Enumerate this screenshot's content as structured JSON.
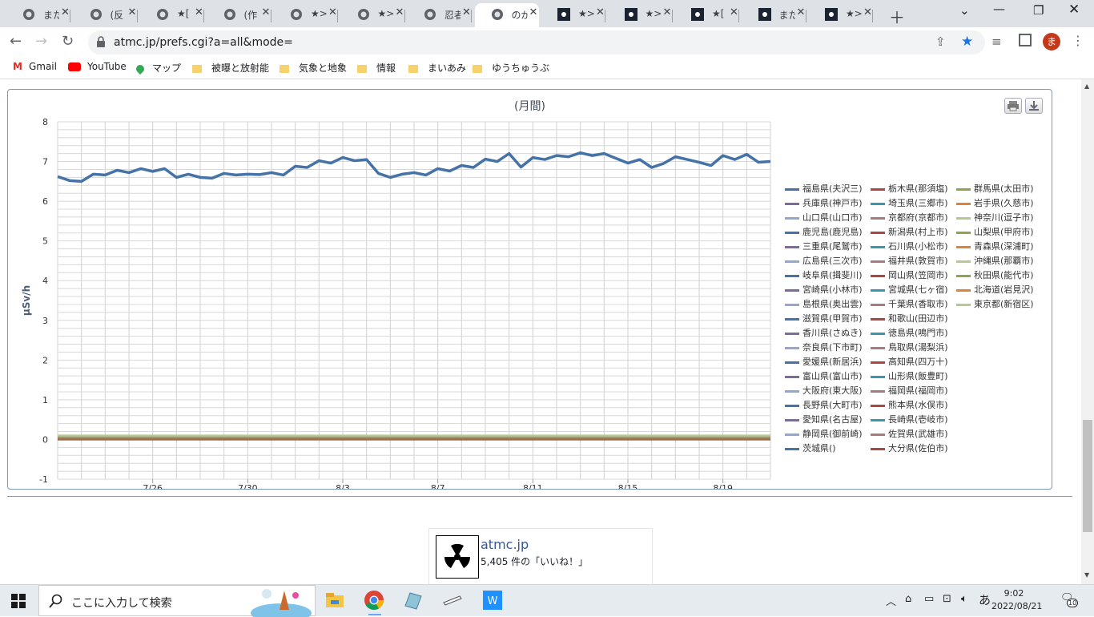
{
  "tabs": [
    {
      "title": "また",
      "active": false,
      "favicon": "globe-icon"
    },
    {
      "title": "(反",
      "active": false,
      "favicon": "globe-icon"
    },
    {
      "title": "★[",
      "active": false,
      "favicon": "globe-icon"
    },
    {
      "title": "(作",
      "active": false,
      "favicon": "globe-icon"
    },
    {
      "title": "★>",
      "active": false,
      "favicon": "globe-icon"
    },
    {
      "title": "★>",
      "active": false,
      "favicon": "globe-icon"
    },
    {
      "title": "忍者",
      "active": false,
      "favicon": "globe-icon"
    },
    {
      "title": "のが",
      "active": true,
      "favicon": "globe-icon"
    },
    {
      "title": "★>",
      "active": false,
      "favicon": "atmc-icon"
    },
    {
      "title": "★>",
      "active": false,
      "favicon": "atmc-icon"
    },
    {
      "title": "★[",
      "active": false,
      "favicon": "atmc-icon"
    },
    {
      "title": "また",
      "active": false,
      "favicon": "atmc-icon"
    },
    {
      "title": "★>",
      "active": false,
      "favicon": "atmc-icon"
    }
  ],
  "toolbar": {
    "url": "atmc.jp/prefs.cgi?a=all&mode=",
    "profile_initial": "ま"
  },
  "bookmarks": [
    {
      "label": "Gmail",
      "icon": "gmail-icon"
    },
    {
      "label": "YouTube",
      "icon": "youtube-icon"
    },
    {
      "label": "マップ",
      "icon": "maps-icon"
    },
    {
      "label": "被曝と放射能",
      "icon": "folder-icon"
    },
    {
      "label": "気象と地象",
      "icon": "folder-icon"
    },
    {
      "label": "情報",
      "icon": "folder-icon"
    },
    {
      "label": "まいあみ",
      "icon": "folder-icon"
    },
    {
      "label": "ゆうちゅうぶ",
      "icon": "folder-icon"
    }
  ],
  "chart_data": {
    "type": "line",
    "title": "(月間)",
    "xlabel": "",
    "ylabel": "μSv/h",
    "ylim": [
      -1,
      8
    ],
    "y_ticks": [
      "8",
      "7",
      "6",
      "5",
      "4",
      "3",
      "2",
      "1",
      "0",
      "-1"
    ],
    "x_ticks": [
      "7/26",
      "7/30",
      "8/3",
      "8/7",
      "8/11",
      "8/15",
      "8/19"
    ],
    "x_tick_days": [
      4,
      8,
      12,
      16,
      20,
      24,
      28
    ],
    "x_range_days": [
      0,
      30
    ],
    "grid": true,
    "legend_position": "right",
    "featured_series": {
      "name": "福島県(夫沢三)",
      "color": "#4572a7",
      "x_days": [
        0,
        0.5,
        1,
        1.5,
        2,
        2.5,
        3,
        3.5,
        4,
        4.5,
        5,
        5.5,
        6,
        6.5,
        7,
        7.5,
        8,
        8.5,
        9,
        9.5,
        10,
        10.5,
        11,
        11.5,
        12,
        12.5,
        13,
        13.5,
        14,
        14.5,
        15,
        15.5,
        16,
        16.5,
        17,
        17.5,
        18,
        18.5,
        19,
        19.5,
        20,
        20.5,
        21,
        21.5,
        22,
        22.5,
        23,
        23.5,
        24,
        24.5,
        25,
        25.5,
        26,
        26.5,
        27,
        27.5,
        28,
        28.5,
        29,
        29.5,
        30
      ],
      "values": [
        6.62,
        6.52,
        6.5,
        6.68,
        6.66,
        6.78,
        6.72,
        6.82,
        6.75,
        6.82,
        6.6,
        6.68,
        6.6,
        6.58,
        6.7,
        6.66,
        6.68,
        6.67,
        6.72,
        6.66,
        6.88,
        6.85,
        7.02,
        6.96,
        7.1,
        7.02,
        7.05,
        6.7,
        6.6,
        6.68,
        6.72,
        6.66,
        6.82,
        6.76,
        6.9,
        6.85,
        7.06,
        7.0,
        7.2,
        6.86,
        7.1,
        7.05,
        7.15,
        7.12,
        7.22,
        7.15,
        7.2,
        7.08,
        6.96,
        7.05,
        6.85,
        6.95,
        7.12,
        7.05,
        6.98,
        6.9,
        7.15,
        7.05,
        7.18,
        6.98,
        7.0
      ]
    },
    "baseline_series_value": 0.05,
    "series_names": [
      "福島県(夫沢三)",
      "栃木県(那須塩)",
      "群馬県(太田市)",
      "兵庫県(神戸市)",
      "埼玉県(三郷市)",
      "岩手県(久慈市)",
      "山口県(山口市)",
      "京都府(京都市)",
      "神奈川(逗子市)",
      "鹿児島(鹿児島)",
      "新潟県(村上市)",
      "山梨県(甲府市)",
      "三重県(尾鷲市)",
      "石川県(小松市)",
      "青森県(深浦町)",
      "広島県(三次市)",
      "福井県(敦賀市)",
      "沖縄県(那覇市)",
      "岐阜県(揖斐川)",
      "岡山県(笠岡市)",
      "秋田県(能代市)",
      "宮崎県(小林市)",
      "宮城県(七ヶ宿)",
      "北海道(岩見沢)",
      "島根県(奥出雲)",
      "千葉県(香取市)",
      "東京都(新宿区)",
      "滋賀県(甲賀市)",
      "和歌山(田辺市)",
      "",
      "香川県(さぬき)",
      "徳島県(鳴門市)",
      "",
      "奈良県(下市町)",
      "鳥取県(湯梨浜)",
      "",
      "愛媛県(新居浜)",
      "高知県(四万十)",
      "",
      "富山県(富山市)",
      "山形県(飯豊町)",
      "",
      "大阪府(東大阪)",
      "福岡県(福岡市)",
      "",
      "長野県(大町市)",
      "熊本県(水俣市)",
      "",
      "愛知県(名古屋)",
      "長崎県(壱岐市)",
      "",
      "静岡県(御前崎)",
      "佐賀県(武雄市)",
      "",
      "茨城県()",
      "大分県(佐伯市)",
      ""
    ],
    "series_colors": [
      "#4572a7",
      "#aa4643",
      "#89a54e",
      "#80699b",
      "#3d96ae",
      "#db843d",
      "#92a8cd",
      "#a47d7c",
      "#b5ca92"
    ]
  },
  "facebook": {
    "name": "atmc.jp",
    "likes": "5,405 件の「いいね！」"
  },
  "taskbar": {
    "search_placeholder": "ここに入力して検索",
    "time": "9:02",
    "date": "2022/08/21",
    "ime": "あ",
    "notifications": "10"
  }
}
